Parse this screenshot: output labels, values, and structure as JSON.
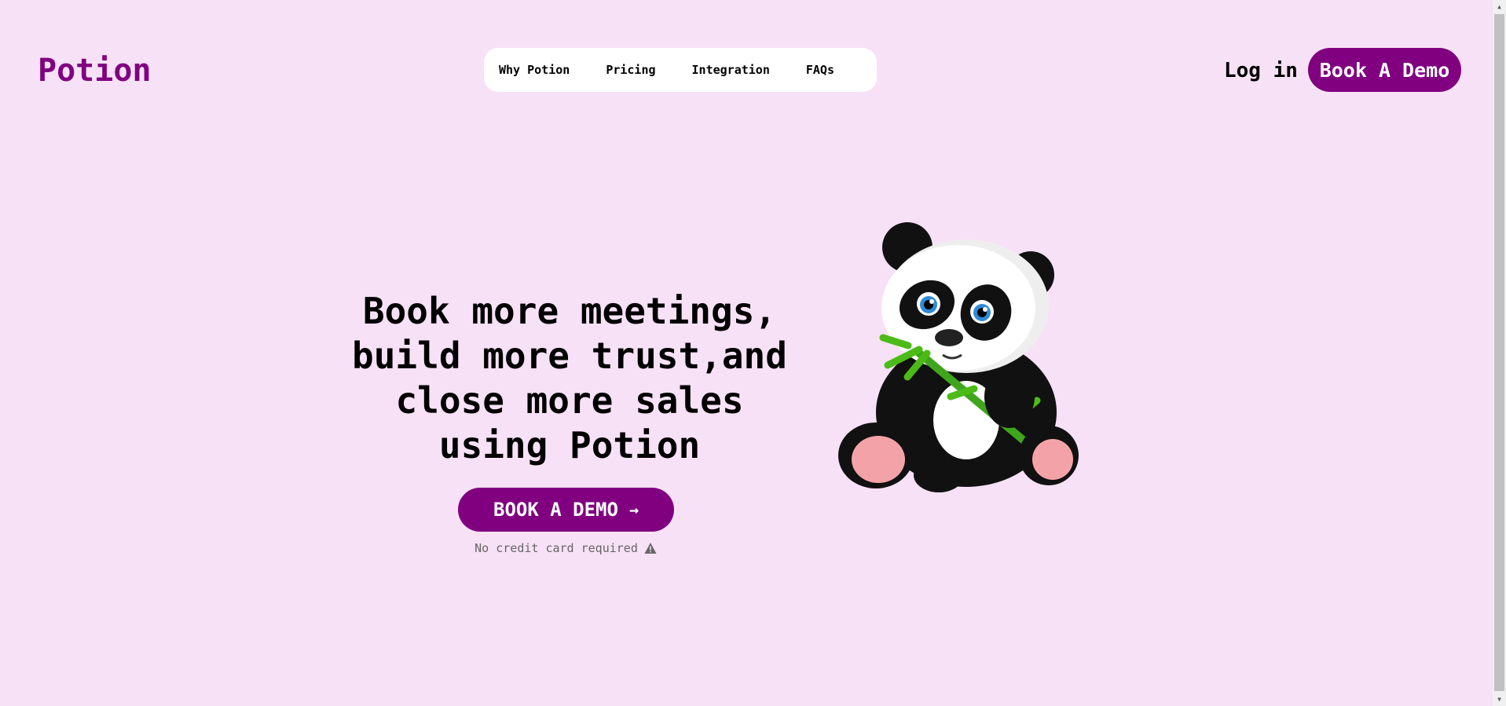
{
  "header": {
    "logo": "Potion",
    "nav": [
      "Why Potion",
      "Pricing",
      "Integration",
      "FAQs"
    ],
    "login_label": "Log in",
    "demo_label": "Book A Demo"
  },
  "hero": {
    "title_lines": [
      "Book more meetings,",
      "build more trust,and",
      "close more sales",
      "using Potion"
    ],
    "cta_label": "BOOK A DEMO",
    "cta_icon": "arrow-right-icon",
    "note": "No credit card required",
    "note_icon": "warning-icon",
    "illustration": "panda-eating-bamboo"
  },
  "colors": {
    "background": "#f7e1f6",
    "accent": "#800080",
    "nav_bg": "#ffffff"
  }
}
